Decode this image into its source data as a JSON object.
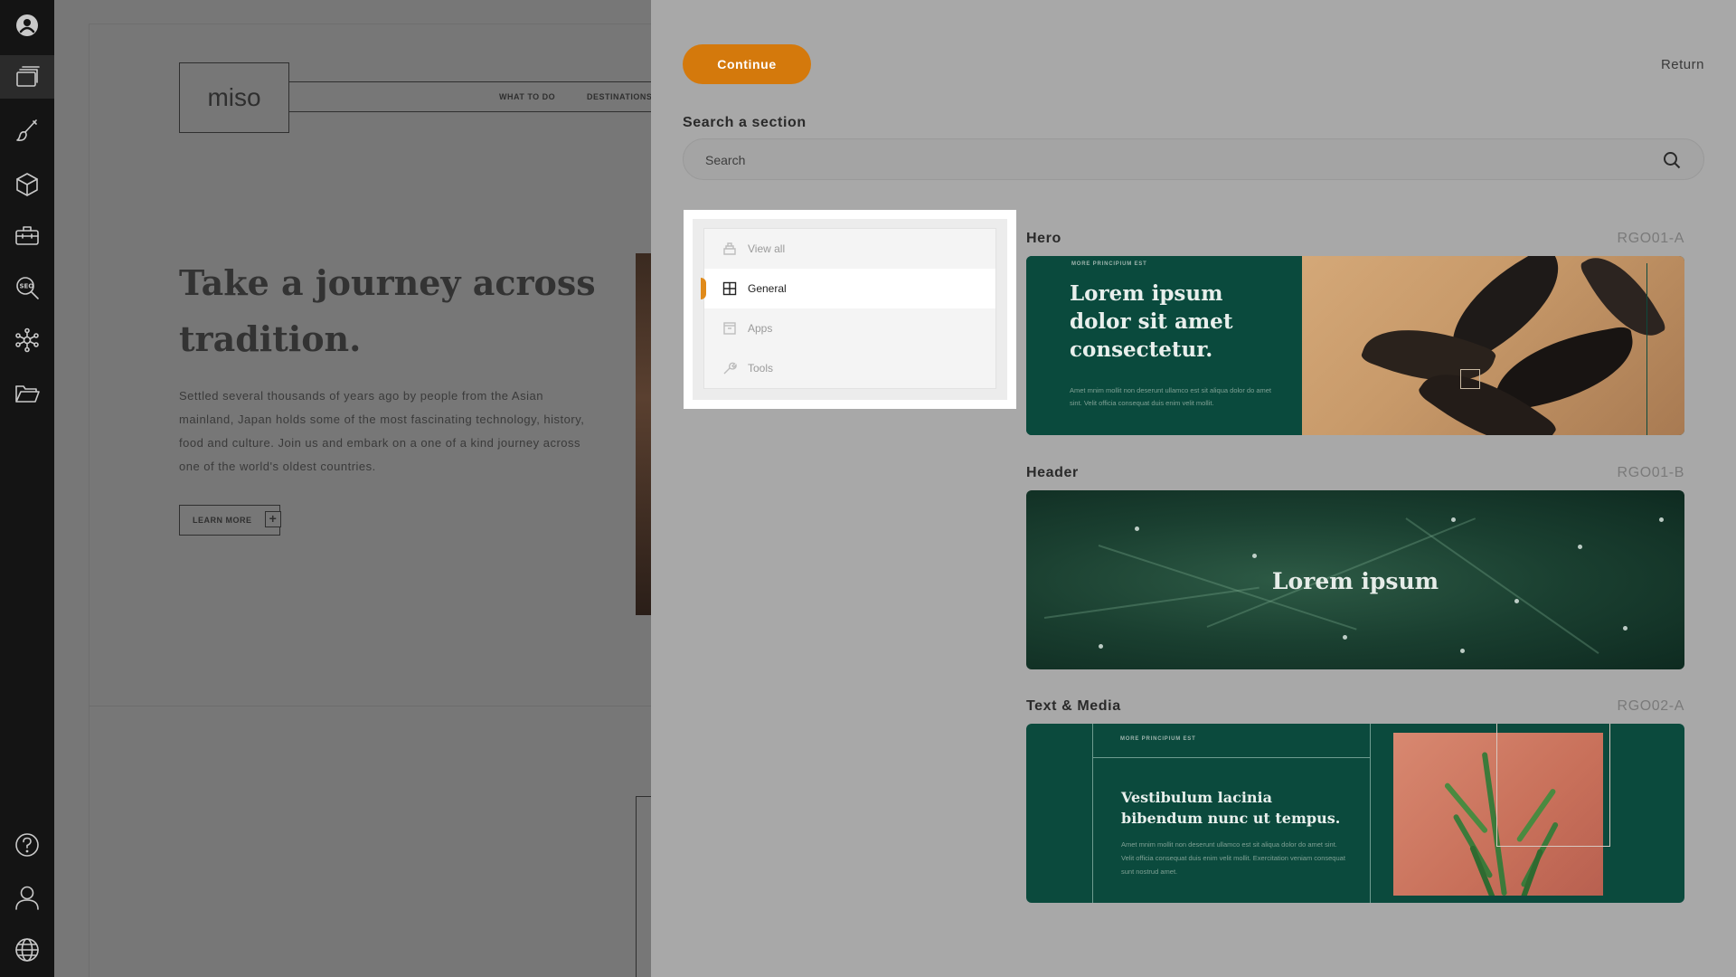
{
  "rail": {
    "top_icons": [
      "logo-icon",
      "layers-icon",
      "brush-icon",
      "cube-icon",
      "toolbox-icon",
      "seo-icon",
      "network-icon",
      "folder-icon"
    ],
    "bottom_icons": [
      "help-icon",
      "user-icon",
      "globe-icon"
    ]
  },
  "preview": {
    "logo": "miso",
    "nav": [
      "WHAT TO DO",
      "DESTINATIONS"
    ],
    "title": "Take a journey across tradition.",
    "body": "Settled several thousands of years ago by people from the Asian mainland, Japan holds some of the most fascinating technology, history, food and culture. Join us and embark on a one of a kind journey across one of the world's oldest countries.",
    "cta": "LEARN MORE"
  },
  "panel": {
    "continue_label": "Continue",
    "return_label": "Return",
    "search_label": "Search a section",
    "search_placeholder": "Search",
    "categories": [
      {
        "label": "View all",
        "icon": "view-all-icon",
        "active": false
      },
      {
        "label": "General",
        "icon": "grid-icon",
        "active": true
      },
      {
        "label": "Apps",
        "icon": "app-box-icon",
        "active": false
      },
      {
        "label": "Tools",
        "icon": "wrench-icon",
        "active": false
      }
    ],
    "accent_color": "#d4790c",
    "sections": [
      {
        "title": "Hero",
        "code": "RGO01-A",
        "kicker": "MORE PRINCIPIUM EST",
        "heading": "Lorem ipsum dolor sit amet consectetur.",
        "body": "Amet mnim mollit non deserunt ullamco est sit aliqua dolor do amet sint. Velit officia consequat duis enim velit mollit."
      },
      {
        "title": "Header",
        "code": "RGO01-B",
        "heading": "Lorem ipsum"
      },
      {
        "title": "Text & Media",
        "code": "RGO02-A",
        "kicker": "MORE PRINCIPIUM EST",
        "heading": "Vestibulum lacinia bibendum nunc ut tempus.",
        "body": "Amet mnim mollit non deserunt ullamco est sit aliqua dolor do amet sint. Velit officia consequat duis enim velit mollit. Exercitation veniam consequat sunt nostrud amet."
      }
    ]
  }
}
